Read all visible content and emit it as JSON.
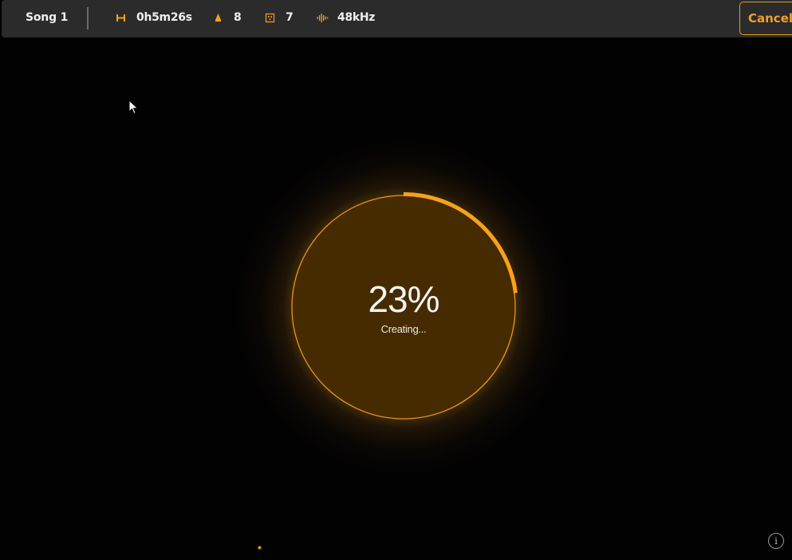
{
  "header": {
    "song_title": "Song 1",
    "duration": "0h5m26s",
    "tracks": "8",
    "bars": "7",
    "sample_rate": "48kHz",
    "cancel_label": "Cancel",
    "icons": [
      "duration-icon",
      "tracks-icon",
      "bars-icon",
      "waveform-icon"
    ]
  },
  "progress": {
    "percent_label": "23%",
    "fraction": 0.23,
    "status": "Creating..."
  },
  "info_button": {
    "glyph": "i"
  },
  "colors": {
    "accent": "#f5a21e",
    "ring_fill": "#472b00",
    "background": "#030203",
    "toolbar": "#2b2b2b"
  }
}
